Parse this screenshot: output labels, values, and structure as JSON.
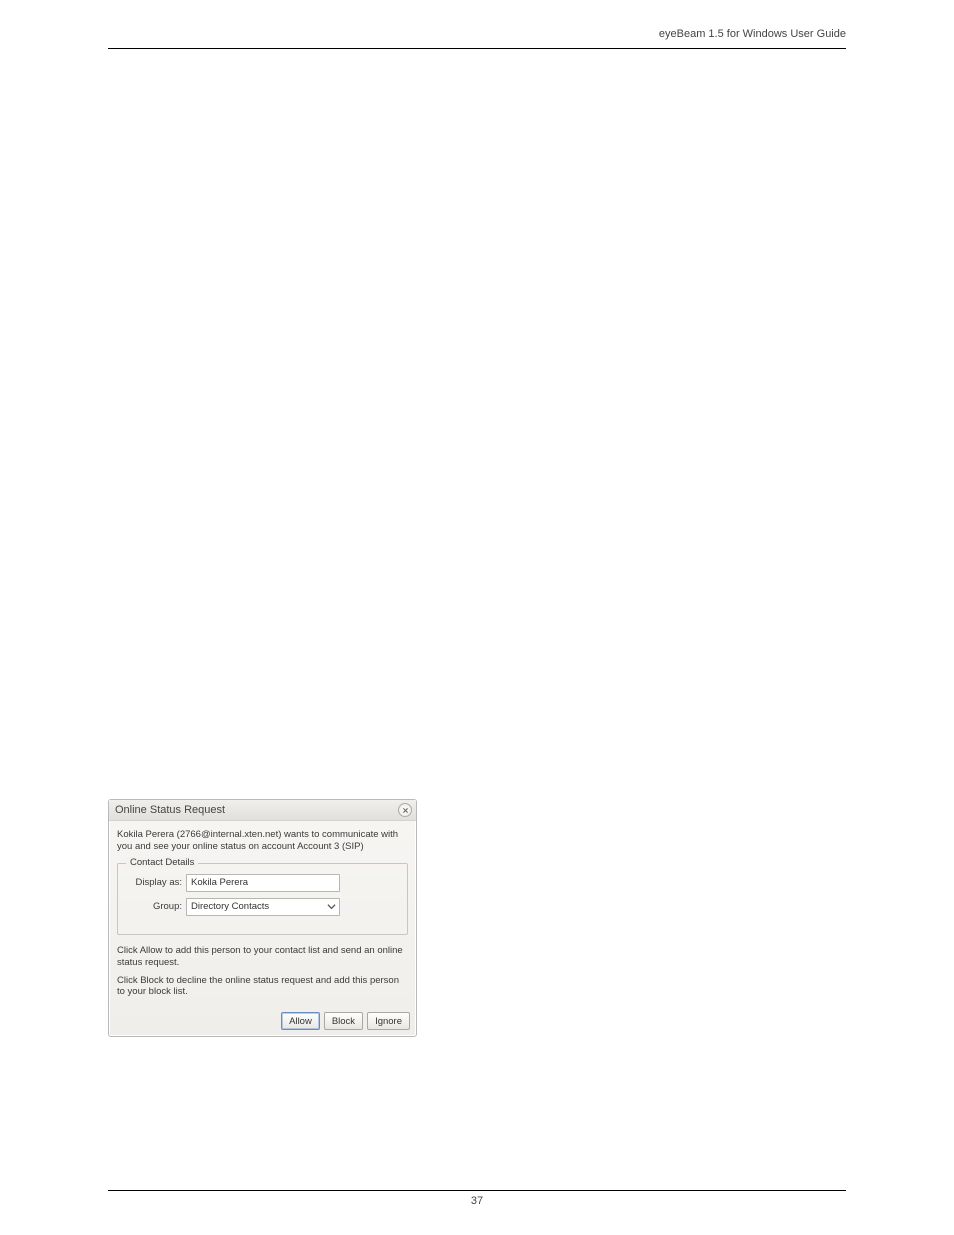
{
  "header": {
    "doc_title": "eyeBeam 1.5 for Windows User Guide"
  },
  "dialog": {
    "title": "Online Status Request",
    "request_text": "Kokila Perera (2766@internal.xten.net)  wants to communicate with you and see your online status on account Account 3 (SIP)",
    "fieldset_legend": "Contact Details",
    "display_as_label": "Display as:",
    "display_as_value": "Kokila Perera",
    "group_label": "Group:",
    "group_value": "Directory Contacts",
    "instr_allow": "Click Allow to add this person to your contact list and send an online status request.",
    "instr_block": "Click Block to decline the online status request and add this person to your block list.",
    "buttons": {
      "allow": "Allow",
      "block": "Block",
      "ignore": "Ignore"
    }
  },
  "footer": {
    "page": "37"
  }
}
